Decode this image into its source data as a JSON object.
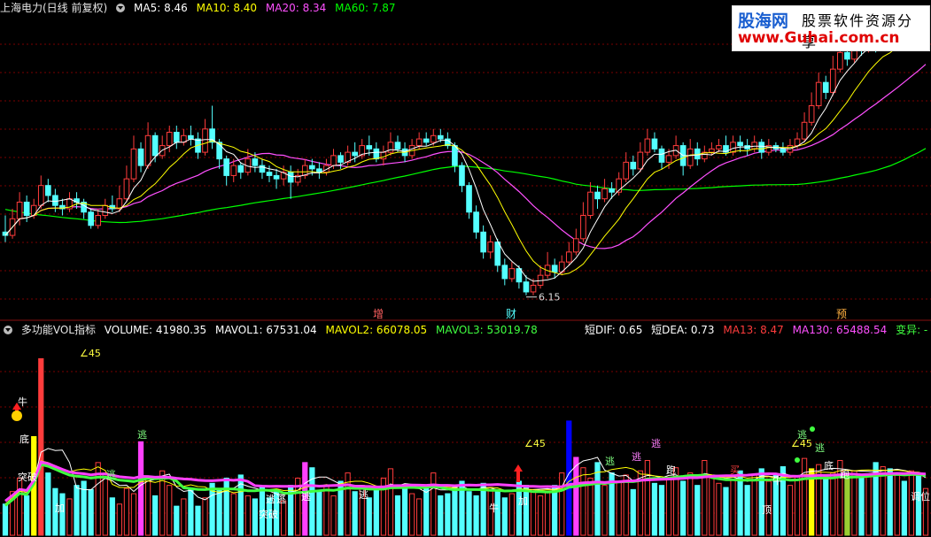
{
  "colors": {
    "background": "#000000",
    "grid": "#7a0000",
    "divider": "#8a1010",
    "up": "#ff3c3c",
    "down": "#54ffff",
    "ma5": "#ffffff",
    "ma10": "#ffff00",
    "ma20": "#ff50ff",
    "ma60": "#00ff00",
    "vol_pink": "#ff40ff",
    "vol_green": "#40ff40"
  },
  "top_info": {
    "title": "上海电力(日线 前复权)",
    "ma5": "MA5: 8.46",
    "ma10": "MA10: 8.40",
    "ma20": "MA20: 8.34",
    "ma60": "MA60: 7.87"
  },
  "vol_info": {
    "name": "多功能VOL指标",
    "volume": "VOLUME: 41980.35",
    "mavol1": "MAVOL1: 67531.04",
    "mavol2": "MAVOL2: 66078.05",
    "mavol3": "MAVOL3: 53019.78"
  },
  "ind_info": {
    "dif": "短DIF: 0.65",
    "dea": "短DEA: 0.73",
    "ma13": "MA13: 8.47",
    "ma130": "MA130: 65488.54",
    "change": "变异: -"
  },
  "watermark": {
    "line1": "股海网",
    "line2": "股票软件资源分享",
    "line3": "www.Guhai.com.cn"
  },
  "chart_data": [
    {
      "type": "candlestick",
      "title": "上海电力(日线 前复权)",
      "low_annotation": "6.15",
      "event_markers": [
        "增",
        "财",
        "预"
      ],
      "series": [
        {
          "name": "MA5",
          "last": 8.46
        },
        {
          "name": "MA10",
          "last": 8.4
        },
        {
          "name": "MA20",
          "last": 8.34
        },
        {
          "name": "MA60",
          "last": 7.87
        }
      ],
      "candles": [
        [
          7.1,
          7.05,
          7.35,
          6.95
        ],
        [
          7.05,
          7.3,
          7.45,
          7.0
        ],
        [
          7.3,
          7.55,
          7.7,
          7.2
        ],
        [
          7.55,
          7.35,
          7.65,
          7.25
        ],
        [
          7.35,
          7.5,
          7.6,
          7.3
        ],
        [
          7.5,
          7.8,
          7.95,
          7.45
        ],
        [
          7.8,
          7.65,
          7.9,
          7.55
        ],
        [
          7.65,
          7.5,
          7.75,
          7.4
        ],
        [
          7.5,
          7.45,
          7.6,
          7.35
        ],
        [
          7.45,
          7.6,
          7.7,
          7.4
        ],
        [
          7.6,
          7.55,
          7.7,
          7.45
        ],
        [
          7.55,
          7.4,
          7.6,
          7.3
        ],
        [
          7.4,
          7.2,
          7.45,
          7.15
        ],
        [
          7.2,
          7.35,
          7.45,
          7.15
        ],
        [
          7.35,
          7.5,
          7.6,
          7.3
        ],
        [
          7.5,
          7.45,
          7.65,
          7.4
        ],
        [
          7.45,
          7.6,
          7.8,
          7.4
        ],
        [
          7.6,
          7.9,
          8.1,
          7.55
        ],
        [
          7.9,
          8.35,
          8.55,
          7.85
        ],
        [
          8.35,
          8.1,
          8.45,
          8.0
        ],
        [
          8.1,
          8.55,
          8.75,
          8.05
        ],
        [
          8.55,
          8.25,
          8.6,
          8.15
        ],
        [
          8.25,
          8.4,
          8.55,
          8.2
        ],
        [
          8.4,
          8.6,
          8.7,
          8.3
        ],
        [
          8.6,
          8.45,
          8.7,
          8.35
        ],
        [
          8.45,
          8.55,
          8.65,
          8.4
        ],
        [
          8.55,
          8.5,
          8.7,
          8.4
        ],
        [
          8.5,
          8.3,
          8.6,
          8.2
        ],
        [
          8.3,
          8.65,
          8.8,
          8.25
        ],
        [
          8.65,
          8.45,
          9.0,
          8.35
        ],
        [
          8.45,
          8.2,
          8.5,
          8.05
        ],
        [
          8.2,
          7.95,
          8.25,
          7.8
        ],
        [
          7.95,
          8.1,
          8.2,
          7.85
        ],
        [
          8.1,
          8.0,
          8.15,
          7.9
        ],
        [
          8.0,
          8.2,
          8.35,
          7.95
        ],
        [
          8.2,
          8.1,
          8.3,
          8.0
        ],
        [
          8.1,
          8.0,
          8.2,
          7.9
        ],
        [
          8.0,
          7.95,
          8.1,
          7.85
        ],
        [
          7.95,
          7.9,
          8.05,
          7.75
        ],
        [
          7.9,
          8.0,
          8.1,
          7.8
        ],
        [
          8.0,
          7.85,
          8.1,
          7.6
        ],
        [
          7.85,
          7.95,
          8.05,
          7.8
        ],
        [
          7.95,
          8.1,
          8.2,
          7.9
        ],
        [
          8.1,
          8.05,
          8.2,
          7.95
        ],
        [
          8.05,
          8.0,
          8.15,
          7.9
        ],
        [
          8.0,
          8.1,
          8.2,
          7.95
        ],
        [
          8.1,
          8.25,
          8.35,
          8.05
        ],
        [
          8.25,
          8.15,
          8.3,
          8.05
        ],
        [
          8.15,
          8.3,
          8.4,
          8.1
        ],
        [
          8.3,
          8.25,
          8.45,
          8.15
        ],
        [
          8.25,
          8.4,
          8.5,
          8.2
        ],
        [
          8.4,
          8.35,
          8.55,
          8.25
        ],
        [
          8.35,
          8.2,
          8.45,
          8.15
        ],
        [
          8.2,
          8.3,
          8.4,
          8.1
        ],
        [
          8.3,
          8.45,
          8.6,
          8.25
        ],
        [
          8.45,
          8.35,
          8.55,
          8.3
        ],
        [
          8.35,
          8.25,
          8.45,
          8.15
        ],
        [
          8.25,
          8.4,
          8.5,
          8.2
        ],
        [
          8.4,
          8.5,
          8.6,
          8.35
        ],
        [
          8.5,
          8.45,
          8.6,
          8.4
        ],
        [
          8.45,
          8.55,
          8.65,
          8.4
        ],
        [
          8.55,
          8.5,
          8.65,
          8.45
        ],
        [
          8.5,
          8.4,
          8.6,
          8.35
        ],
        [
          8.4,
          8.1,
          8.45,
          8.0
        ],
        [
          8.1,
          7.8,
          8.15,
          7.7
        ],
        [
          7.8,
          7.4,
          7.85,
          7.3
        ],
        [
          7.4,
          7.1,
          7.5,
          7.0
        ],
        [
          7.1,
          6.8,
          7.2,
          6.7
        ],
        [
          6.8,
          6.95,
          7.05,
          6.7
        ],
        [
          6.95,
          6.6,
          7.0,
          6.5
        ],
        [
          6.6,
          6.4,
          6.7,
          6.3
        ],
        [
          6.4,
          6.55,
          6.65,
          6.35
        ],
        [
          6.55,
          6.35,
          6.6,
          6.25
        ],
        [
          6.35,
          6.2,
          6.45,
          6.15
        ],
        [
          6.2,
          6.3,
          6.4,
          6.15
        ],
        [
          6.3,
          6.45,
          6.6,
          6.25
        ],
        [
          6.45,
          6.6,
          6.8,
          6.4
        ],
        [
          6.6,
          6.5,
          6.7,
          6.4
        ],
        [
          6.5,
          6.65,
          6.75,
          6.45
        ],
        [
          6.65,
          6.8,
          6.95,
          6.6
        ],
        [
          6.8,
          7.0,
          7.15,
          6.75
        ],
        [
          7.0,
          7.35,
          7.55,
          6.95
        ],
        [
          7.35,
          7.7,
          7.85,
          7.3
        ],
        [
          7.7,
          7.6,
          7.8,
          7.45
        ],
        [
          7.6,
          7.75,
          7.9,
          7.55
        ],
        [
          7.75,
          7.7,
          7.85,
          7.6
        ],
        [
          7.7,
          7.9,
          8.0,
          7.65
        ],
        [
          7.9,
          8.15,
          8.3,
          7.85
        ],
        [
          8.15,
          8.05,
          8.25,
          7.95
        ],
        [
          8.05,
          8.3,
          8.45,
          8.0
        ],
        [
          8.3,
          8.5,
          8.65,
          8.25
        ],
        [
          8.5,
          8.35,
          8.6,
          8.3
        ],
        [
          8.35,
          8.15,
          8.4,
          8.05
        ],
        [
          8.15,
          8.25,
          8.35,
          8.05
        ],
        [
          8.25,
          8.4,
          8.55,
          8.2
        ],
        [
          8.4,
          8.1,
          8.45,
          7.95
        ],
        [
          8.1,
          8.35,
          8.5,
          8.05
        ],
        [
          8.35,
          8.2,
          8.45,
          8.1
        ],
        [
          8.2,
          8.3,
          8.4,
          8.15
        ],
        [
          8.3,
          8.35,
          8.45,
          8.25
        ],
        [
          8.35,
          8.4,
          8.5,
          8.3
        ],
        [
          8.4,
          8.3,
          8.55,
          8.25
        ],
        [
          8.3,
          8.45,
          8.55,
          8.25
        ],
        [
          8.45,
          8.4,
          8.55,
          8.3
        ],
        [
          8.4,
          8.35,
          8.5,
          8.25
        ],
        [
          8.35,
          8.45,
          8.55,
          8.3
        ],
        [
          8.45,
          8.3,
          8.5,
          8.2
        ],
        [
          8.3,
          8.4,
          8.5,
          8.25
        ],
        [
          8.4,
          8.35,
          8.45,
          8.3
        ],
        [
          8.35,
          8.3,
          8.45,
          8.25
        ],
        [
          8.3,
          8.4,
          8.5,
          8.25
        ],
        [
          8.4,
          8.5,
          8.6,
          8.35
        ],
        [
          8.5,
          8.75,
          8.9,
          8.45
        ],
        [
          8.75,
          9.0,
          9.2,
          8.7
        ],
        [
          9.0,
          9.35,
          9.5,
          8.95
        ],
        [
          9.35,
          9.2,
          9.45,
          9.1
        ],
        [
          9.2,
          9.55,
          9.75,
          9.15
        ],
        [
          9.55,
          9.8,
          10.0,
          9.5
        ],
        [
          9.8,
          9.7,
          9.95,
          9.6
        ],
        [
          9.7,
          9.95,
          10.1,
          9.65
        ],
        [
          9.95,
          9.85,
          10.1,
          9.75
        ],
        [
          9.85,
          10.0,
          10.15,
          9.8
        ],
        [
          10.0,
          9.9,
          10.1,
          9.8
        ],
        [
          9.9,
          10.05,
          10.15,
          9.85
        ],
        [
          10.05,
          9.95,
          10.15,
          9.85
        ],
        [
          9.95,
          10.1,
          10.2,
          9.9
        ],
        [
          10.1,
          10.0,
          10.2,
          9.9
        ],
        [
          10.0,
          10.15,
          10.25,
          9.95
        ],
        [
          10.15,
          10.05,
          10.25,
          9.95
        ],
        [
          10.05,
          10.2,
          10.3,
          10.0
        ]
      ]
    },
    {
      "type": "bar",
      "title": "多功能VOL指标",
      "series": [
        {
          "name": "VOLUME",
          "last": 41980.35
        },
        {
          "name": "MAVOL1",
          "last": 67531.04
        },
        {
          "name": "MAVOL2",
          "last": 66078.05
        },
        {
          "name": "MAVOL3",
          "last": 53019.78
        }
      ],
      "signal_labels": [
        "牛",
        "底",
        "突破",
        "加",
        "∠45",
        "逃",
        "逃",
        "逃",
        "逃",
        "突破",
        "逃",
        "逃",
        "牛",
        "∠45",
        "加",
        "逃",
        "逃",
        "逃",
        "跑",
        "买",
        "牛",
        "∠45",
        "逃",
        "顶",
        "逃",
        "底",
        "跑",
        "调位"
      ],
      "volumes": [
        30,
        42,
        55,
        38,
        95,
        170,
        60,
        45,
        40,
        35,
        48,
        52,
        44,
        70,
        60,
        36,
        30,
        45,
        40,
        90,
        56,
        38,
        62,
        48,
        28,
        35,
        44,
        28,
        36,
        50,
        45,
        55,
        40,
        58,
        38,
        35,
        46,
        36,
        44,
        33,
        48,
        55,
        70,
        65,
        42,
        48,
        38,
        52,
        60,
        42,
        48,
        36,
        44,
        55,
        64,
        38,
        48,
        40,
        35,
        45,
        60,
        38,
        40,
        48,
        52,
        42,
        38,
        50,
        46,
        42,
        36,
        40,
        52,
        48,
        44,
        38,
        42,
        48,
        60,
        110,
        75,
        65,
        55,
        70,
        48,
        60,
        52,
        58,
        44,
        62,
        72,
        50,
        48,
        56,
        65,
        52,
        60,
        48,
        72,
        58,
        50,
        46,
        54,
        62,
        48,
        58,
        64,
        52,
        58,
        66,
        48,
        56,
        74,
        64,
        68,
        56,
        60,
        72,
        60,
        62,
        55,
        58,
        70,
        66,
        64,
        60,
        52,
        62,
        58,
        45
      ]
    }
  ]
}
